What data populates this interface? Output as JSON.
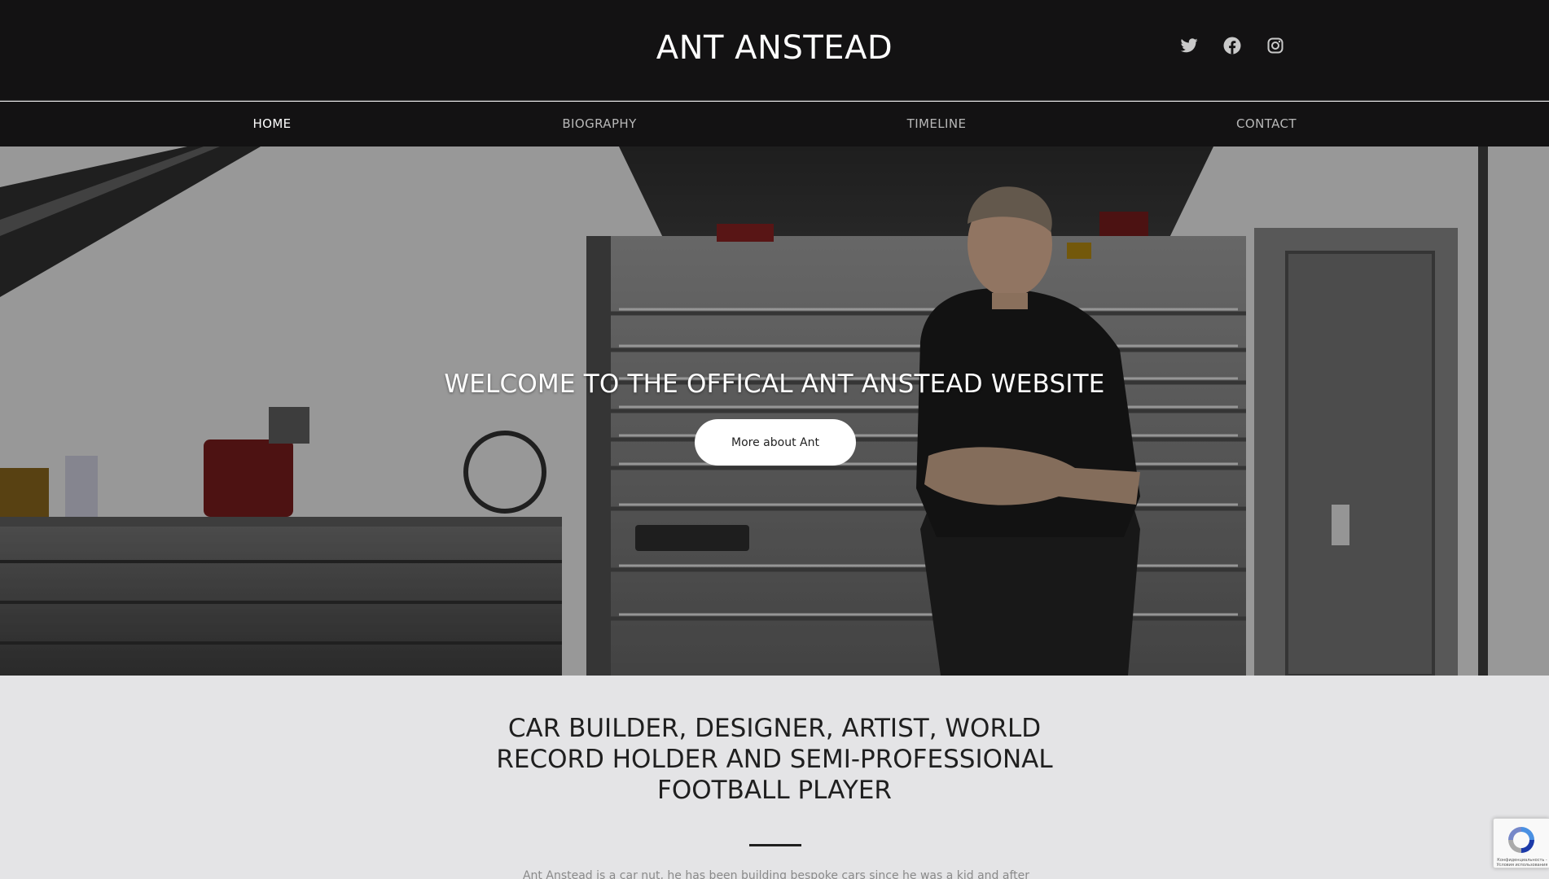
{
  "header": {
    "title": "ANT ANSTEAD",
    "social": [
      {
        "icon": "twitter-icon",
        "label": "Twitter"
      },
      {
        "icon": "facebook-icon",
        "label": "Facebook"
      },
      {
        "icon": "instagram-icon",
        "label": "Instagram"
      }
    ]
  },
  "nav": {
    "items": [
      {
        "label": "HOME",
        "active": true
      },
      {
        "label": "BIOGRAPHY",
        "active": false
      },
      {
        "label": "TIMELINE",
        "active": false
      },
      {
        "label": "CONTACT",
        "active": false
      }
    ]
  },
  "hero": {
    "title": "WELCOME TO THE OFFICAL ANT ANSTEAD WEBSITE",
    "button_label": "More about Ant",
    "image_description": "Mac Tools tool chests in a workshop, man in black t-shirt with arms crossed"
  },
  "about": {
    "heading": "CAR BUILDER, DESIGNER, ARTIST, WORLD RECORD HOLDER AND SEMI-PROFESSIONAL FOOTBALL PLAYER",
    "text": "Ant Anstead is a car nut, he has been building bespoke cars since he was a kid and after"
  },
  "recaptcha": {
    "text": "Конфиденциальность - Условия использования"
  },
  "colors": {
    "header_bg": "#131213",
    "about_bg": "#e4e4e6",
    "nav_text": "#b8b8b8",
    "nav_active": "#ffffff"
  }
}
